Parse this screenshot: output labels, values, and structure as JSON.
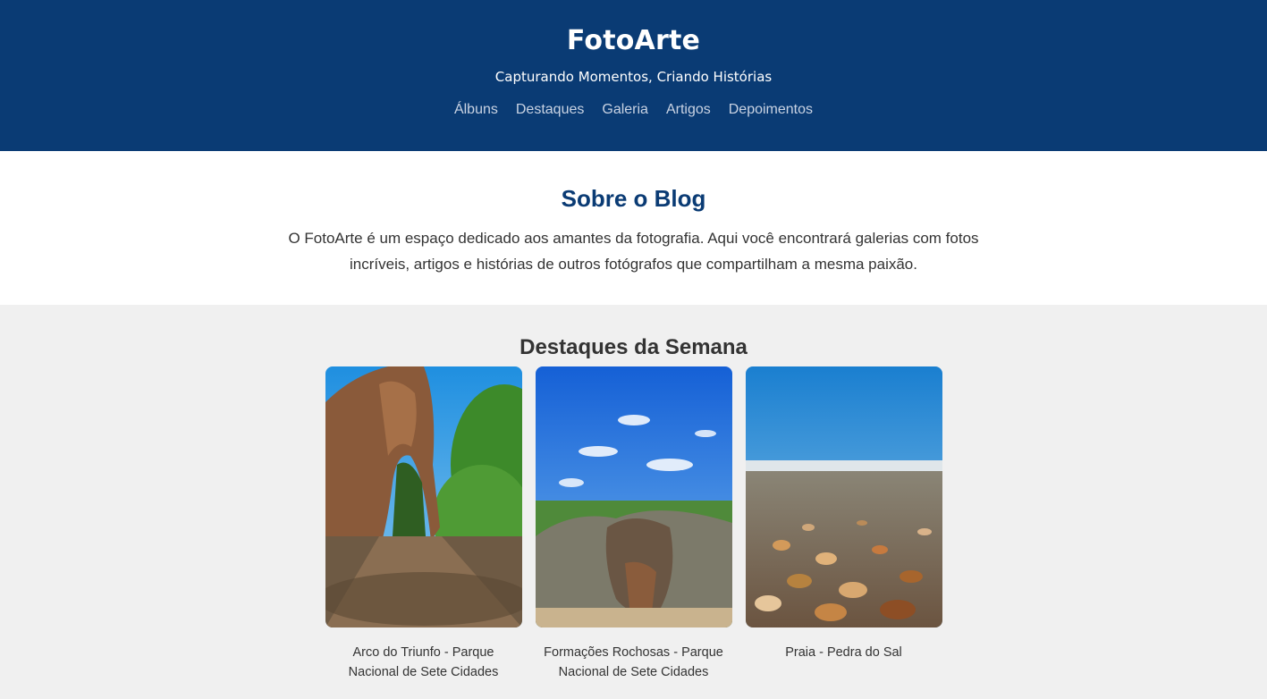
{
  "header": {
    "brand": "FotoArte",
    "tagline": "Capturando Momentos, Criando Histórias",
    "nav": [
      "Álbuns",
      "Destaques",
      "Galeria",
      "Artigos",
      "Depoimentos"
    ]
  },
  "about": {
    "title": "Sobre o Blog",
    "text": "O FotoArte é um espaço dedicado aos amantes da fotografia. Aqui você encontrará galerias com fotos incríveis, artigos e histórias de outros fotógrafos que compartilham a mesma paixão."
  },
  "featured": {
    "title": "Destaques da Semana",
    "cards": [
      {
        "caption": "Arco do Triunfo - Parque Nacional de Sete Cidades"
      },
      {
        "caption": "Formações Rochosas - Parque Nacional de Sete Cidades"
      },
      {
        "caption": "Praia - Pedra do Sal"
      }
    ]
  },
  "colors": {
    "header_bg": "#0a3b74",
    "accent": "#0a3b74",
    "page_bg": "#f0f0f0"
  }
}
